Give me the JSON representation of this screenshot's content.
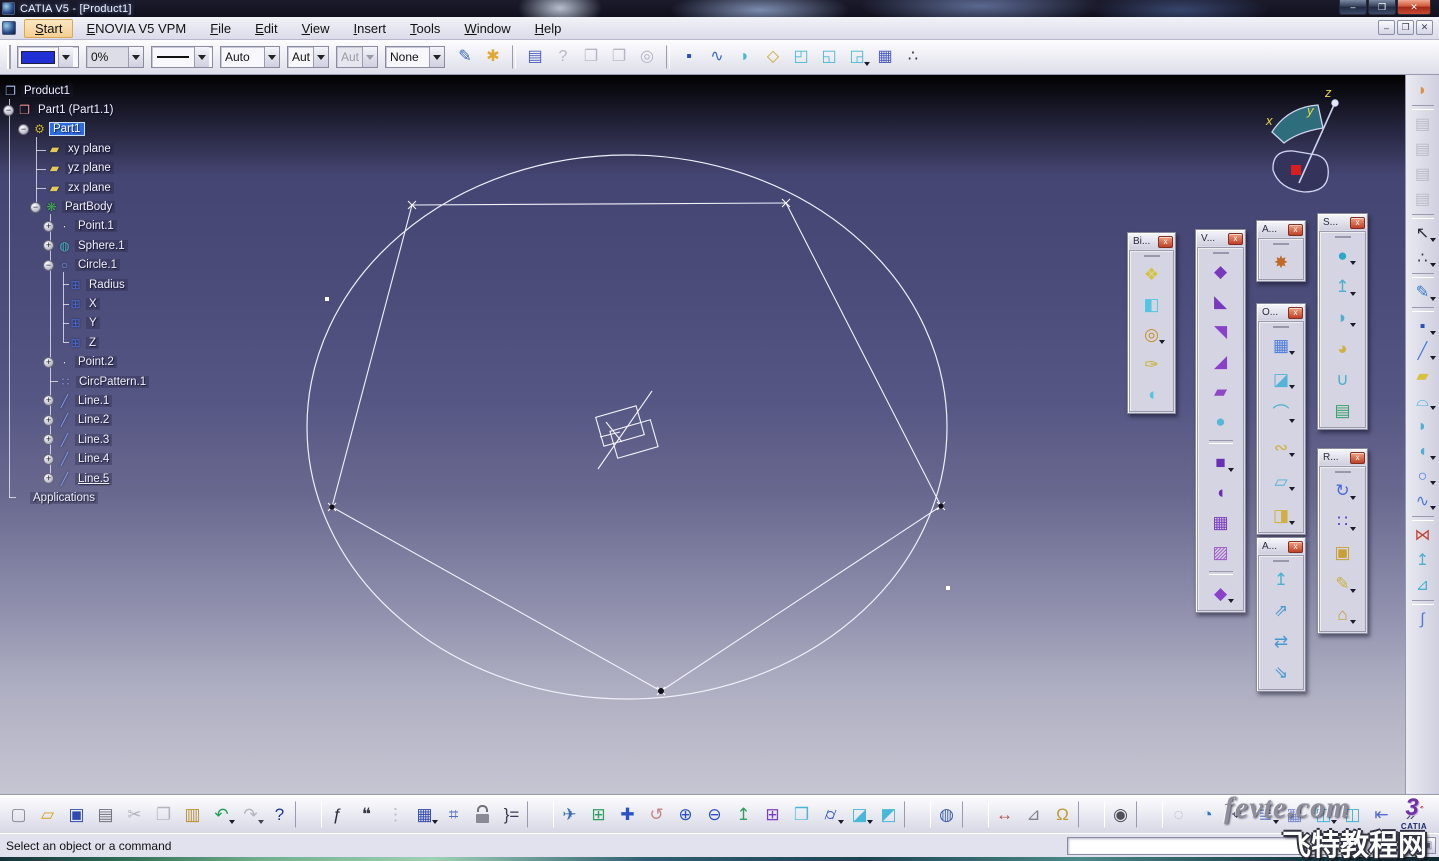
{
  "ui": {
    "close": "x",
    "min": "–",
    "max": "❐",
    "restore": "❐",
    "close_x": "✕"
  },
  "window": {
    "title": "CATIA V5 - [Product1]"
  },
  "menu": {
    "items": [
      {
        "name": "menu-start",
        "pre": "",
        "hot": "S",
        "post": "tart",
        "cls": "active"
      },
      {
        "name": "menu-enovia",
        "pre": "",
        "hot": "E",
        "post": "NOVIA V5 VPM"
      },
      {
        "name": "menu-file",
        "pre": "",
        "hot": "F",
        "post": "ile"
      },
      {
        "name": "menu-edit",
        "pre": "",
        "hot": "E",
        "post": "dit"
      },
      {
        "name": "menu-view",
        "pre": "",
        "hot": "V",
        "post": "iew"
      },
      {
        "name": "menu-insert",
        "pre": "",
        "hot": "I",
        "post": "nsert"
      },
      {
        "name": "menu-tools",
        "pre": "",
        "hot": "T",
        "post": "ools"
      },
      {
        "name": "menu-window",
        "pre": "",
        "hot": "W",
        "post": "indow"
      },
      {
        "name": "menu-help",
        "pre": "",
        "hot": "H",
        "post": "elp"
      }
    ]
  },
  "format_toolbar": {
    "color": "#2030d4",
    "weight": "0%",
    "symbol": "Auto",
    "thickness_a": "Aut",
    "thickness_b": "Aut",
    "render": "None",
    "icons": [
      {
        "name": "painter-icon",
        "g": "✎",
        "c": "#3565c8"
      },
      {
        "name": "wizard-icon",
        "g": "✱",
        "c": "#e0a830"
      },
      {
        "name": "separator",
        "g": "",
        "cls": "sep"
      },
      {
        "name": "properties-icon",
        "g": "▤",
        "c": "#4a5ac0"
      },
      {
        "name": "link-help-icon",
        "g": "?",
        "c": "#a8a8b6",
        "cls": "dis"
      },
      {
        "name": "link-copy-icon",
        "g": "❐",
        "c": "#a8a8b6",
        "cls": "dis"
      },
      {
        "name": "link-paste-icon",
        "g": "❐",
        "c": "#a8a8b6",
        "cls": "dis"
      },
      {
        "name": "search-links-icon",
        "g": "◎",
        "c": "#a8a8b6",
        "cls": "dis"
      },
      {
        "name": "separator",
        "g": "",
        "cls": "sep"
      },
      {
        "name": "create-point-icon",
        "g": "▪",
        "c": "#2b4fc0"
      },
      {
        "name": "create-curve-icon",
        "g": "∿",
        "c": "#3565c8"
      },
      {
        "name": "create-surface-icon",
        "g": "◗",
        "c": "#49b8d8"
      },
      {
        "name": "create-plane-icon",
        "g": "◇",
        "c": "#c8a838"
      },
      {
        "name": "select-box-icon",
        "g": "◰",
        "c": "#49b8d8"
      },
      {
        "name": "select-box-behind-icon",
        "g": "◱",
        "c": "#49b8d8"
      },
      {
        "name": "select-group-icon",
        "g": "◲",
        "c": "#49b8d8",
        "cls": "dd"
      },
      {
        "name": "select-grid-icon",
        "g": "▦",
        "c": "#4a5ac0"
      },
      {
        "name": "select-splash-icon",
        "g": "∴",
        "c": "#30303e"
      }
    ]
  },
  "tree": {
    "items": [
      {
        "name": "tree-item-product1",
        "label": "Product1",
        "pad": "p0",
        "exp": "",
        "g": "❐",
        "c": "#9cc0ee"
      },
      {
        "name": "tree-item-part1-1",
        "label": "Part1 (Part1.1)",
        "pad": "p1",
        "exp": "−",
        "g": "❐",
        "c": "#e89090"
      },
      {
        "name": "tree-item-part1",
        "label": "Part1",
        "pad": "p2",
        "exp": "−",
        "g": "⚙",
        "c": "#c8b030",
        "cls": "sel"
      },
      {
        "name": "tree-item-xy-plane",
        "label": "xy plane",
        "pad": "p3",
        "exp": "",
        "g": "▰",
        "c": "#e4cc54"
      },
      {
        "name": "tree-item-yz-plane",
        "label": "yz plane",
        "pad": "p3",
        "exp": "",
        "g": "▰",
        "c": "#e4cc54"
      },
      {
        "name": "tree-item-zx-plane",
        "label": "zx plane",
        "pad": "p3",
        "exp": "",
        "g": "▰",
        "c": "#e4cc54"
      },
      {
        "name": "tree-item-partbody",
        "label": "PartBody",
        "pad": "p3e",
        "exp": "−",
        "g": "❋",
        "c": "#3fae52"
      },
      {
        "name": "tree-item-point1",
        "label": "Point.1",
        "pad": "p4",
        "exp": "+",
        "g": "∙",
        "c": "#e8e8f4"
      },
      {
        "name": "tree-item-sphere1",
        "label": "Sphere.1",
        "pad": "p4",
        "exp": "+",
        "g": "◍",
        "c": "#46b4bc"
      },
      {
        "name": "tree-item-circle1",
        "label": "Circle.1",
        "pad": "p4",
        "exp": "−",
        "g": "○",
        "c": "#6f9ef0"
      },
      {
        "name": "tree-item-radius",
        "label": "Radius",
        "pad": "p5",
        "exp": "",
        "g": "⊞",
        "c": "#4a6ad0"
      },
      {
        "name": "tree-item-x",
        "label": "X",
        "pad": "p5",
        "exp": "",
        "g": "⊞",
        "c": "#4a6ad0"
      },
      {
        "name": "tree-item-y",
        "label": "Y",
        "pad": "p5",
        "exp": "",
        "g": "⊞",
        "c": "#4a6ad0"
      },
      {
        "name": "tree-item-z",
        "label": "Z",
        "pad": "p5",
        "exp": "",
        "g": "⊞",
        "c": "#4a6ad0"
      },
      {
        "name": "tree-item-point2",
        "label": "Point.2",
        "pad": "p4",
        "exp": "+",
        "g": "∙",
        "c": "#e8e8f4"
      },
      {
        "name": "tree-item-circpattern1",
        "label": "CircPattern.1",
        "pad": "p4n",
        "exp": "",
        "g": "∷",
        "c": "#7f96ec"
      },
      {
        "name": "tree-item-line1",
        "label": "Line.1",
        "pad": "p4",
        "exp": "+",
        "g": "╱",
        "c": "#7f9ef0"
      },
      {
        "name": "tree-item-line2",
        "label": "Line.2",
        "pad": "p4",
        "exp": "+",
        "g": "╱",
        "c": "#7f9ef0"
      },
      {
        "name": "tree-item-line3",
        "label": "Line.3",
        "pad": "p4",
        "exp": "+",
        "g": "╱",
        "c": "#7f9ef0"
      },
      {
        "name": "tree-item-line4",
        "label": "Line.4",
        "pad": "p4",
        "exp": "+",
        "g": "╱",
        "c": "#7f9ef0"
      },
      {
        "name": "tree-item-line5",
        "label": "Line.5",
        "pad": "p4",
        "exp": "+",
        "g": "╱",
        "c": "#7f9ef0",
        "cls": "und"
      },
      {
        "name": "tree-item-applications",
        "label": "Applications",
        "pad": "p0a",
        "exp": "",
        "g": "",
        "c": ""
      }
    ]
  },
  "compass": {
    "x": "x",
    "y": "y",
    "z": "z"
  },
  "floats": [
    {
      "title": "Bi...",
      "icons": [
        {
          "name": "split-icon",
          "g": "❖",
          "c": "#d6c23e"
        },
        {
          "name": "trim-icon",
          "g": "◧",
          "c": "#52c4e4"
        },
        {
          "name": "boundary-icon",
          "g": "◎",
          "c": "#c89030",
          "cls": "dd"
        },
        {
          "name": "surface-sketch-icon",
          "g": "✑",
          "c": "#c8b23a"
        },
        {
          "name": "cut-surface-icon",
          "g": "◖",
          "c": "#52c4e4"
        }
      ]
    },
    {
      "title": "V...",
      "icons": [
        {
          "name": "volume-extrude-icon",
          "g": "◆",
          "c": "#7a38bc"
        },
        {
          "name": "volume-drag-icon",
          "g": "◣",
          "c": "#7a38bc"
        },
        {
          "name": "volume-revolve-icon",
          "g": "◥",
          "c": "#8a40c8"
        },
        {
          "name": "volume-draft-icon",
          "g": "◢",
          "c": "#8a40c8"
        },
        {
          "name": "volume-multi-icon",
          "g": "▰",
          "c": "#9048c8"
        },
        {
          "name": "volume-cylinder-icon",
          "g": "●",
          "c": "#55b8d4"
        },
        {
          "name": "separator",
          "g": "",
          "cls": "sep"
        },
        {
          "name": "thick-block-icon",
          "g": "■",
          "c": "#6a30b4",
          "cls": "dd"
        },
        {
          "name": "shell-icon",
          "g": "◖",
          "c": "#6a30b4"
        },
        {
          "name": "sew-surface-icon",
          "g": "▦",
          "c": "#7a38bc"
        },
        {
          "name": "volume-pattern-icon",
          "g": "▨",
          "c": "#a058c8"
        },
        {
          "name": "separator",
          "g": "",
          "cls": "sep"
        },
        {
          "name": "volume-boolean-icon",
          "g": "◆",
          "c": "#8a40c8",
          "cls": "dd"
        }
      ]
    },
    {
      "title": "A...",
      "icons": [
        {
          "name": "axis-splash-icon",
          "g": "✸",
          "c": "#c06a28"
        }
      ]
    },
    {
      "title": "O...",
      "icons": [
        {
          "name": "checker-pattern-icon",
          "g": "▦",
          "c": "#4a7ae0",
          "cls": "dd"
        },
        {
          "name": "split-trim-icon",
          "g": "◪",
          "c": "#52b4d8",
          "cls": "dd"
        },
        {
          "name": "healing-icon",
          "g": "⌒",
          "c": "#4ab4cc",
          "cls": "dd"
        },
        {
          "name": "curve-smooth-icon",
          "g": "∾",
          "c": "#d0b040",
          "cls": "dd"
        },
        {
          "name": "untrim-icon",
          "g": "▱",
          "c": "#52b4d8",
          "cls": "dd"
        },
        {
          "name": "disassemble-icon",
          "g": "◨",
          "c": "#d0b040",
          "cls": "dd"
        }
      ]
    },
    {
      "title": "S...",
      "icons": [
        {
          "name": "sphere-surface-icon",
          "g": "●",
          "c": "#2aa8c8",
          "cls": "dd"
        },
        {
          "name": "offset-surface-icon",
          "g": "↥",
          "c": "#49b0d0",
          "cls": "dd"
        },
        {
          "name": "swept-surface-icon",
          "g": "◗",
          "c": "#49b0d0",
          "cls": "dd"
        },
        {
          "name": "fill-surface-icon",
          "g": "◕",
          "c": "#d0b040"
        },
        {
          "name": "blend-surface-icon",
          "g": "∪",
          "c": "#49b0d0"
        },
        {
          "name": "multi-section-icon",
          "g": "▤",
          "c": "#3aa068"
        }
      ]
    },
    {
      "title": "R...",
      "icons": [
        {
          "name": "circular-pattern-icon",
          "g": "↻",
          "c": "#4a68d8",
          "cls": "dd"
        },
        {
          "name": "user-pattern-icon",
          "g": "∷",
          "c": "#6040c8",
          "cls": "dd"
        },
        {
          "name": "powercopy-icon",
          "g": "▣",
          "c": "#c8a035"
        },
        {
          "name": "powercopy-save-icon",
          "g": "✎",
          "c": "#c8b040",
          "cls": "dd"
        },
        {
          "name": "catalog-icon",
          "g": "⌂",
          "c": "#c09a30",
          "cls": "dd"
        }
      ]
    },
    {
      "title": "A...",
      "icons": [
        {
          "name": "axis-to-axis-icon",
          "g": "↥",
          "c": "#49b0d0"
        },
        {
          "name": "translate-icon",
          "g": "⇗",
          "c": "#4898d0"
        },
        {
          "name": "symmetry-icon",
          "g": "⇄",
          "c": "#4898d0"
        },
        {
          "name": "scaling-icon",
          "g": "⇘",
          "c": "#4898d0"
        }
      ]
    }
  ],
  "right_toolbar": {
    "icons": [
      {
        "name": "workbench-icon",
        "g": "◗",
        "c": "#e09040"
      },
      {
        "name": "separator",
        "g": "",
        "cls": "sep"
      },
      {
        "name": "catalog-window-icon-1",
        "g": "▤",
        "c": "#b2b2c0",
        "cls": "dis"
      },
      {
        "name": "catalog-window-icon-2",
        "g": "▤",
        "c": "#b2b2c0",
        "cls": "dis"
      },
      {
        "name": "catalog-window-icon-3",
        "g": "▤",
        "c": "#b2b2c0",
        "cls": "dis"
      },
      {
        "name": "catalog-window-icon-4",
        "g": "▤",
        "c": "#b2b2c0",
        "cls": "dis"
      },
      {
        "name": "separator",
        "g": "",
        "cls": "sep"
      },
      {
        "name": "select-arrow-icon",
        "g": "↖",
        "c": "#2a2a38",
        "cls": "dd"
      },
      {
        "name": "fly-select-icon",
        "g": "∴",
        "c": "#3a3a4a",
        "cls": "dd"
      },
      {
        "name": "separator",
        "g": "",
        "cls": "sep"
      },
      {
        "name": "sketcher-icon",
        "g": "✎",
        "c": "#3878c8",
        "cls": "dd"
      },
      {
        "name": "separator",
        "g": "",
        "cls": "sep"
      },
      {
        "name": "point-icon",
        "g": "▪",
        "c": "#2b4fc0",
        "cls": "dd"
      },
      {
        "name": "line-icon",
        "g": "╱",
        "c": "#4878e0",
        "cls": "dd"
      },
      {
        "name": "plane-icon",
        "g": "▰",
        "c": "#d8c040"
      },
      {
        "name": "extrude-icon",
        "g": "⌓",
        "c": "#49b0d8",
        "cls": "dd"
      },
      {
        "name": "revolve-icon",
        "g": "◗",
        "c": "#49b0d8"
      },
      {
        "name": "sweep-icon",
        "g": "◖",
        "c": "#49b0d8",
        "cls": "dd"
      },
      {
        "name": "circle-icon",
        "g": "○",
        "c": "#4878e0",
        "cls": "dd"
      },
      {
        "name": "spline-icon",
        "g": "∿",
        "c": "#4878e0",
        "cls": "dd"
      },
      {
        "name": "separator",
        "g": "",
        "cls": "sep"
      },
      {
        "name": "join-icon",
        "g": "⋈",
        "c": "#c04838"
      },
      {
        "name": "extrapolate-icon",
        "g": "↥",
        "c": "#49b0d0"
      },
      {
        "name": "extremum-icon",
        "g": "⊿",
        "c": "#49b0d0"
      },
      {
        "name": "separator",
        "g": "",
        "cls": "sep"
      },
      {
        "name": "law-icon",
        "g": "∫",
        "c": "#4878e0"
      }
    ]
  },
  "bottom_toolbar": {
    "icons": [
      {
        "name": "new-document-icon",
        "g": "▢",
        "c": "#8a8a98"
      },
      {
        "name": "open-folder-icon",
        "g": "▱",
        "c": "#d8a020"
      },
      {
        "name": "save-icon",
        "g": "▣",
        "c": "#2f4ab0"
      },
      {
        "name": "print-icon",
        "g": "▤",
        "c": "#70707e"
      },
      {
        "name": "cut-icon",
        "g": "✂",
        "c": "#a6a6b2",
        "cls": "dis"
      },
      {
        "name": "copy-icon",
        "g": "❐",
        "c": "#a6a6b2",
        "cls": "dis"
      },
      {
        "name": "paste-icon",
        "g": "▥",
        "c": "#bb8f35"
      },
      {
        "name": "undo-icon",
        "g": "↶",
        "c": "#23a055",
        "cls": "dd"
      },
      {
        "name": "redo-icon",
        "g": "↷",
        "c": "#a6a6b2",
        "cls": "dis dd"
      },
      {
        "name": "whats-this-icon",
        "g": "?",
        "c": "#1c3a9c"
      },
      {
        "name": "separator",
        "g": "",
        "cls": "sep"
      },
      {
        "name": "formula-icon",
        "g": "ƒ",
        "c": "#2a2a34"
      },
      {
        "name": "comment-icon",
        "g": "❝",
        "c": "#3a3a46"
      },
      {
        "name": "rule-icon",
        "g": "⋮",
        "c": "#b0b0bc",
        "cls": "dis"
      },
      {
        "name": "design-table-icon",
        "g": "▦",
        "c": "#2f4ab0",
        "cls": "dd"
      },
      {
        "name": "reorder-tree-icon",
        "g": "⌗",
        "c": "#5568cc"
      },
      {
        "name": "lock-icon",
        "g": "",
        "c": "#707078",
        "cls": "ico-lock"
      },
      {
        "name": "expand-all-icon",
        "g": "}=",
        "c": "#3a3a52"
      },
      {
        "name": "separator",
        "g": "",
        "cls": "sep"
      },
      {
        "name": "fly-mode-icon",
        "g": "✈",
        "c": "#3f6fb0"
      },
      {
        "name": "fit-all-icon",
        "g": "⊞",
        "c": "#2f9f60"
      },
      {
        "name": "pan-icon",
        "g": "✚",
        "c": "#2b51c8"
      },
      {
        "name": "rotate-icon",
        "g": "↺",
        "c": "#c88484"
      },
      {
        "name": "zoom-in-icon",
        "g": "⊕",
        "c": "#2b51c8"
      },
      {
        "name": "zoom-out-icon",
        "g": "⊖",
        "c": "#2b51c8"
      },
      {
        "name": "normal-view-icon",
        "g": "↥",
        "c": "#2f9f60"
      },
      {
        "name": "quad-view-icon",
        "g": "⊞",
        "c": "#7a3fc1"
      },
      {
        "name": "iso-view-icon",
        "g": "❒",
        "c": "#49b8d8"
      },
      {
        "name": "render-style-icon",
        "g": "⌭",
        "c": "#2b51c8",
        "cls": "dd"
      },
      {
        "name": "hide-show-icon",
        "g": "◪",
        "c": "#49b8d8",
        "cls": "dd"
      },
      {
        "name": "swap-space-icon",
        "g": "◩",
        "c": "#49b8d8"
      },
      {
        "name": "separator",
        "g": "",
        "cls": "sep"
      },
      {
        "name": "material-icon",
        "g": "◍",
        "c": "#3f5fb0"
      },
      {
        "name": "separator",
        "g": "",
        "cls": "sep"
      },
      {
        "name": "measure-icon",
        "g": "↔",
        "c": "#b05050"
      },
      {
        "name": "measure-item-icon",
        "g": "⊿",
        "c": "#80808e"
      },
      {
        "name": "mass-icon",
        "g": "Ω",
        "c": "#c09a30"
      },
      {
        "name": "separator",
        "g": "",
        "cls": "sep"
      },
      {
        "name": "camera-icon",
        "g": "◉",
        "c": "#50505c"
      },
      {
        "name": "separator",
        "g": "",
        "cls": "sep"
      },
      {
        "name": "spiral-icon",
        "g": "◌",
        "c": "#a6a6b2",
        "cls": "dis"
      },
      {
        "name": "pressure-icon",
        "g": "◔",
        "c": "#3070c8"
      },
      {
        "name": "axis-system-icon",
        "g": "⌖",
        "c": "#3a3a52"
      },
      {
        "name": "paper-layout-icon",
        "g": "≣",
        "c": "#7a8ad0",
        "cls": "dd"
      },
      {
        "name": "working-grid-icon",
        "g": "▦",
        "c": "#7a8ad0"
      },
      {
        "name": "visibility-box-icon",
        "g": "◫",
        "c": "#45b4d4",
        "cls": "dd"
      },
      {
        "name": "power-box-icon",
        "g": "◫",
        "c": "#45b4d4"
      },
      {
        "name": "swap-panel-icon",
        "g": "⇤",
        "c": "#5568cc",
        "cls": "gap"
      },
      {
        "name": "overflow-icon",
        "g": "»",
        "c": "#50506a"
      }
    ]
  },
  "brand": {
    "mark": "3",
    "name": "CATIA"
  },
  "status_bar": {
    "message": "Select an object or a command"
  },
  "watermark": {
    "site": "fevte.com",
    "name": "飞特教程网"
  }
}
